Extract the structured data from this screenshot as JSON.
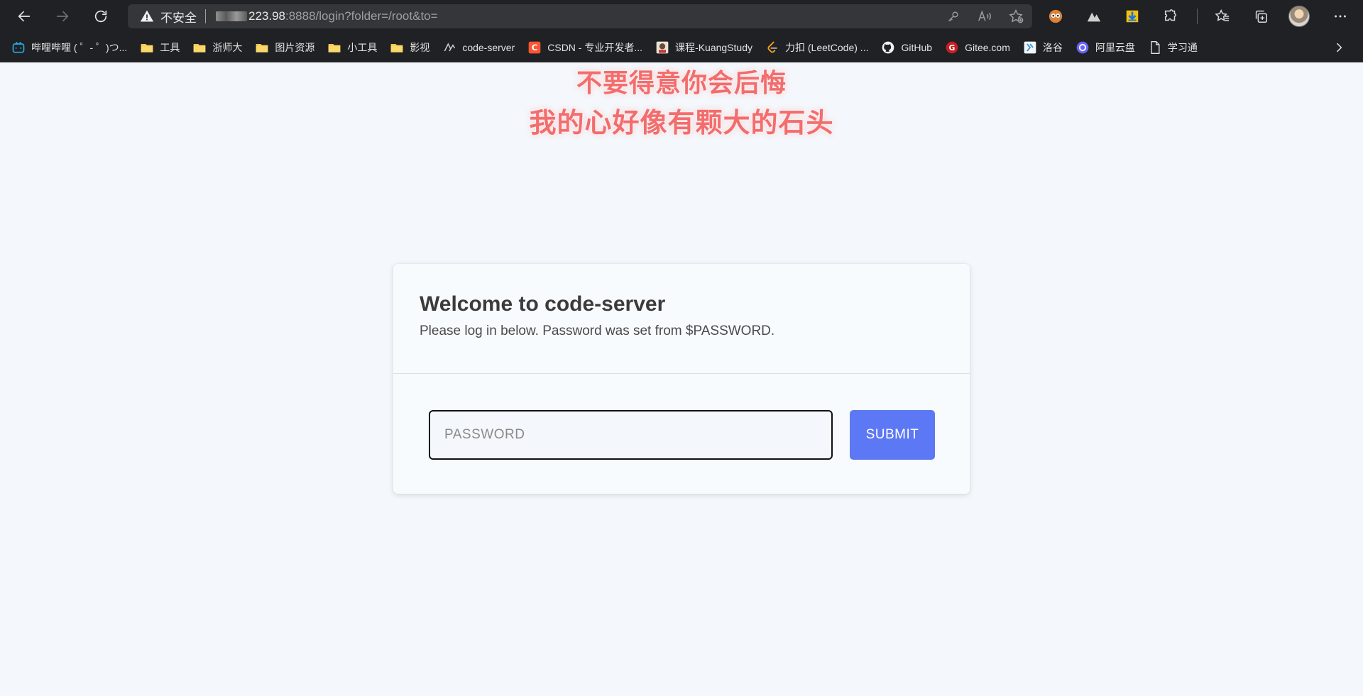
{
  "browser": {
    "security_label": "不安全",
    "url_host": "223.98",
    "url_rest": ":8888/login?folder=/root&to="
  },
  "bookmarks": [
    {
      "label": "哔哩哔哩 ( ゜- ゜)つ...",
      "icon": "bilibili-icon"
    },
    {
      "label": "工具",
      "icon": "folder-icon"
    },
    {
      "label": "浙师大",
      "icon": "folder-icon"
    },
    {
      "label": "图片资源",
      "icon": "folder-icon"
    },
    {
      "label": "小工具",
      "icon": "folder-icon"
    },
    {
      "label": "影视",
      "icon": "folder-icon"
    },
    {
      "label": "code-server",
      "icon": "code-server-icon"
    },
    {
      "label": "CSDN - 专业开发者...",
      "icon": "csdn-icon"
    },
    {
      "label": "课程-KuangStudy",
      "icon": "kuangstudy-icon"
    },
    {
      "label": "力扣 (LeetCode) ...",
      "icon": "leetcode-icon"
    },
    {
      "label": "GitHub",
      "icon": "github-icon"
    },
    {
      "label": "Gitee.com",
      "icon": "gitee-icon"
    },
    {
      "label": "洛谷",
      "icon": "luogu-icon"
    },
    {
      "label": "阿里云盘",
      "icon": "aliyun-drive-icon"
    },
    {
      "label": "学习通",
      "icon": "page-icon"
    }
  ],
  "banner": {
    "line1": "不要得意你会后悔",
    "line2": "我的心好像有颗大的石头"
  },
  "login": {
    "title": "Welcome to code-server",
    "subtitle": "Please log in below. Password was set from $PASSWORD.",
    "password_placeholder": "PASSWORD",
    "submit_label": "SUBMIT"
  },
  "colors": {
    "submit": "#5d78f5",
    "banner": "#f26d6d",
    "page_bg": "#f4f7fb"
  }
}
